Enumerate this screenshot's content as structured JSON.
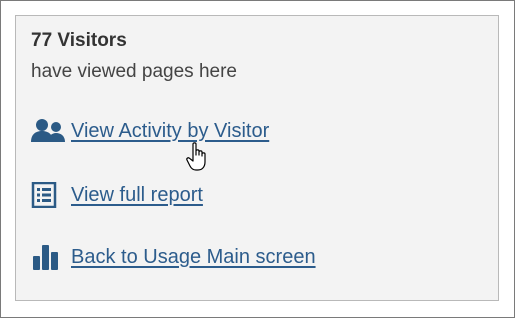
{
  "summary": {
    "count_label": "77 Visitors",
    "description": "have viewed pages here"
  },
  "links": [
    {
      "label": "View Activity by Visitor",
      "icon": "users-icon"
    },
    {
      "label": "View full report",
      "icon": "report-list-icon"
    },
    {
      "label": "Back to Usage Main screen",
      "icon": "bar-chart-icon"
    }
  ],
  "colors": {
    "link": "#2c5c8c",
    "icon": "#2b5a85",
    "panel_bg": "#f3f3f3"
  }
}
